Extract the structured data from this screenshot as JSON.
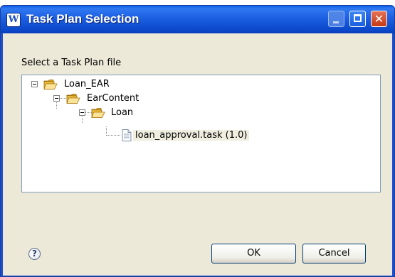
{
  "window": {
    "title": "Task Plan Selection",
    "app_icon": "W",
    "icons": {
      "app": "app-logo-icon",
      "minimize": "minimize-icon",
      "maximize": "maximize-icon",
      "close": "close-icon"
    },
    "close_glyph": "✕"
  },
  "dialog": {
    "prompt": "Select a Task Plan file",
    "tree": [
      {
        "label": "Loan_EAR",
        "icon": "folder-open-icon",
        "expanded": true
      },
      {
        "label": "EarContent",
        "icon": "folder-open-icon",
        "expanded": true
      },
      {
        "label": "Loan",
        "icon": "folder-open-icon",
        "expanded": true
      },
      {
        "label": "loan_approval.task (1.0)",
        "icon": "file-icon",
        "selected": true
      }
    ],
    "help_glyph": "?",
    "buttons": {
      "ok": "OK",
      "cancel": "Cancel"
    }
  },
  "colors": {
    "title_bar": "#0a47c9",
    "client_background": "#ece9d8",
    "tree_border": "#7f9db9",
    "close_button": "#c43915"
  }
}
